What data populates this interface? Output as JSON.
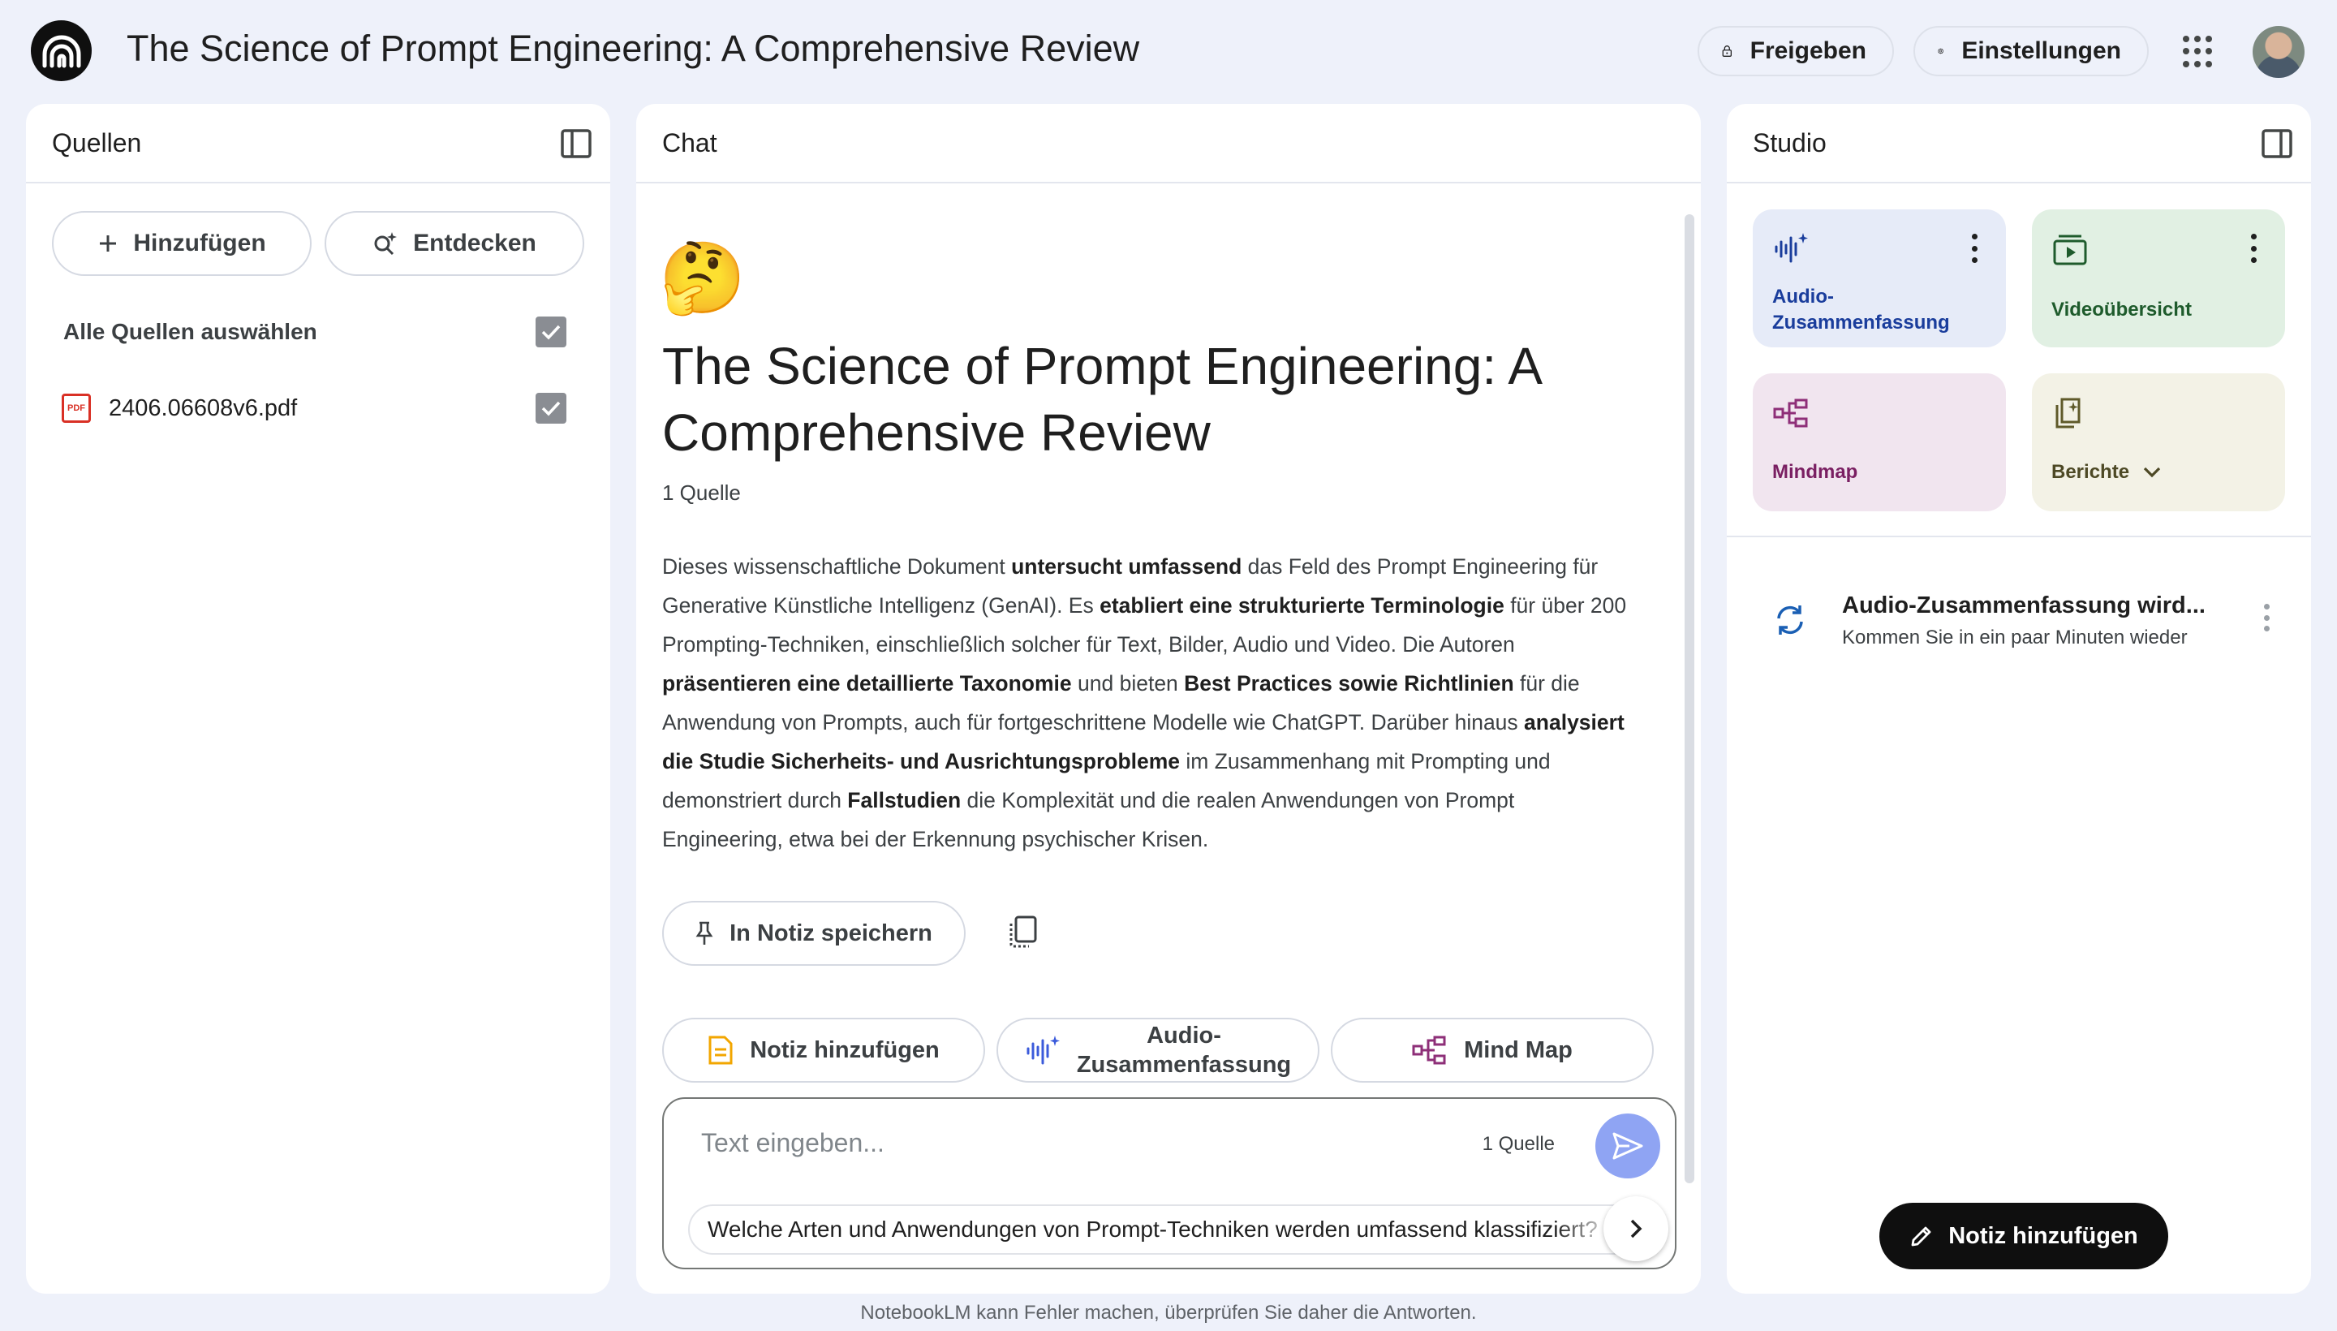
{
  "header": {
    "title": "The Science of Prompt Engineering: A Comprehensive Review",
    "share_label": "Freigeben",
    "settings_label": "Einstellungen"
  },
  "sources": {
    "title": "Quellen",
    "add_label": "Hinzufügen",
    "discover_label": "Entdecken",
    "select_all_label": "Alle Quellen auswählen",
    "select_all_checked": true,
    "files": [
      {
        "name": "2406.06608v6.pdf",
        "type_badge": "PDF",
        "checked": true
      }
    ]
  },
  "chat": {
    "title": "Chat",
    "emoji": "🤔",
    "notebook_title": "The Science of Prompt Engineering: A Comprehensive Review",
    "source_count": "1 Quelle",
    "summary": [
      {
        "t": "Dieses wissenschaftliche Dokument ",
        "b": false
      },
      {
        "t": "untersucht umfassend",
        "b": true
      },
      {
        "t": " das Feld des Prompt Engineering für Generative Künstliche Intelligenz (GenAI). Es ",
        "b": false
      },
      {
        "t": "etabliert eine strukturierte Terminologie",
        "b": true
      },
      {
        "t": " für über 200 Prompting-Techniken, einschließlich solcher für Text, Bilder, Audio und Video. Die Autoren ",
        "b": false
      },
      {
        "t": "präsentieren eine detaillierte Taxonomie",
        "b": true
      },
      {
        "t": " und bieten ",
        "b": false
      },
      {
        "t": "Best Practices sowie Richtlinien",
        "b": true
      },
      {
        "t": " für die Anwendung von Prompts, auch für fortgeschrittene Modelle wie ChatGPT. Darüber hinaus ",
        "b": false
      },
      {
        "t": "analysiert die Studie Sicherheits- und Ausrichtungsprobleme",
        "b": true
      },
      {
        "t": " im Zusammenhang mit Prompting und demonstriert durch ",
        "b": false
      },
      {
        "t": "Fallstudien",
        "b": true
      },
      {
        "t": " die Komplexität und die realen Anwendungen von Prompt Engineering, etwa bei der Erkennung psychischer Krisen.",
        "b": false
      }
    ],
    "save_note_label": "In Notiz speichern",
    "quick_actions": {
      "add_note": "Notiz hinzufügen",
      "audio_line1": "Audio-",
      "audio_line2": "Zusammenfassung",
      "mind_map": "Mind Map"
    },
    "input": {
      "placeholder": "Text eingeben...",
      "source_count": "1 Quelle",
      "suggestion": "Welche Arten und Anwendungen von Prompt-Techniken werden umfassend klassifiziert?"
    }
  },
  "studio": {
    "title": "Studio",
    "tiles": {
      "audio_line1": "Audio-",
      "audio_line2": "Zusammenfassung",
      "video": "Videoübersicht",
      "mindmap": "Mindmap",
      "reports": "Berichte"
    },
    "colors": {
      "audio_bg": "#e6ebf8",
      "video_bg": "#e1f0e3",
      "mindmap_bg": "#f1e5ef",
      "reports_bg": "#f3f2e6"
    },
    "generating": {
      "title": "Audio-Zusammenfassung wird...",
      "subtitle": "Kommen Sie in ein paar Minuten wieder"
    },
    "add_note_label": "Notiz hinzufügen"
  },
  "footer": {
    "disclaimer": "NotebookLM kann Fehler machen, überprüfen Sie daher die Antworten."
  }
}
